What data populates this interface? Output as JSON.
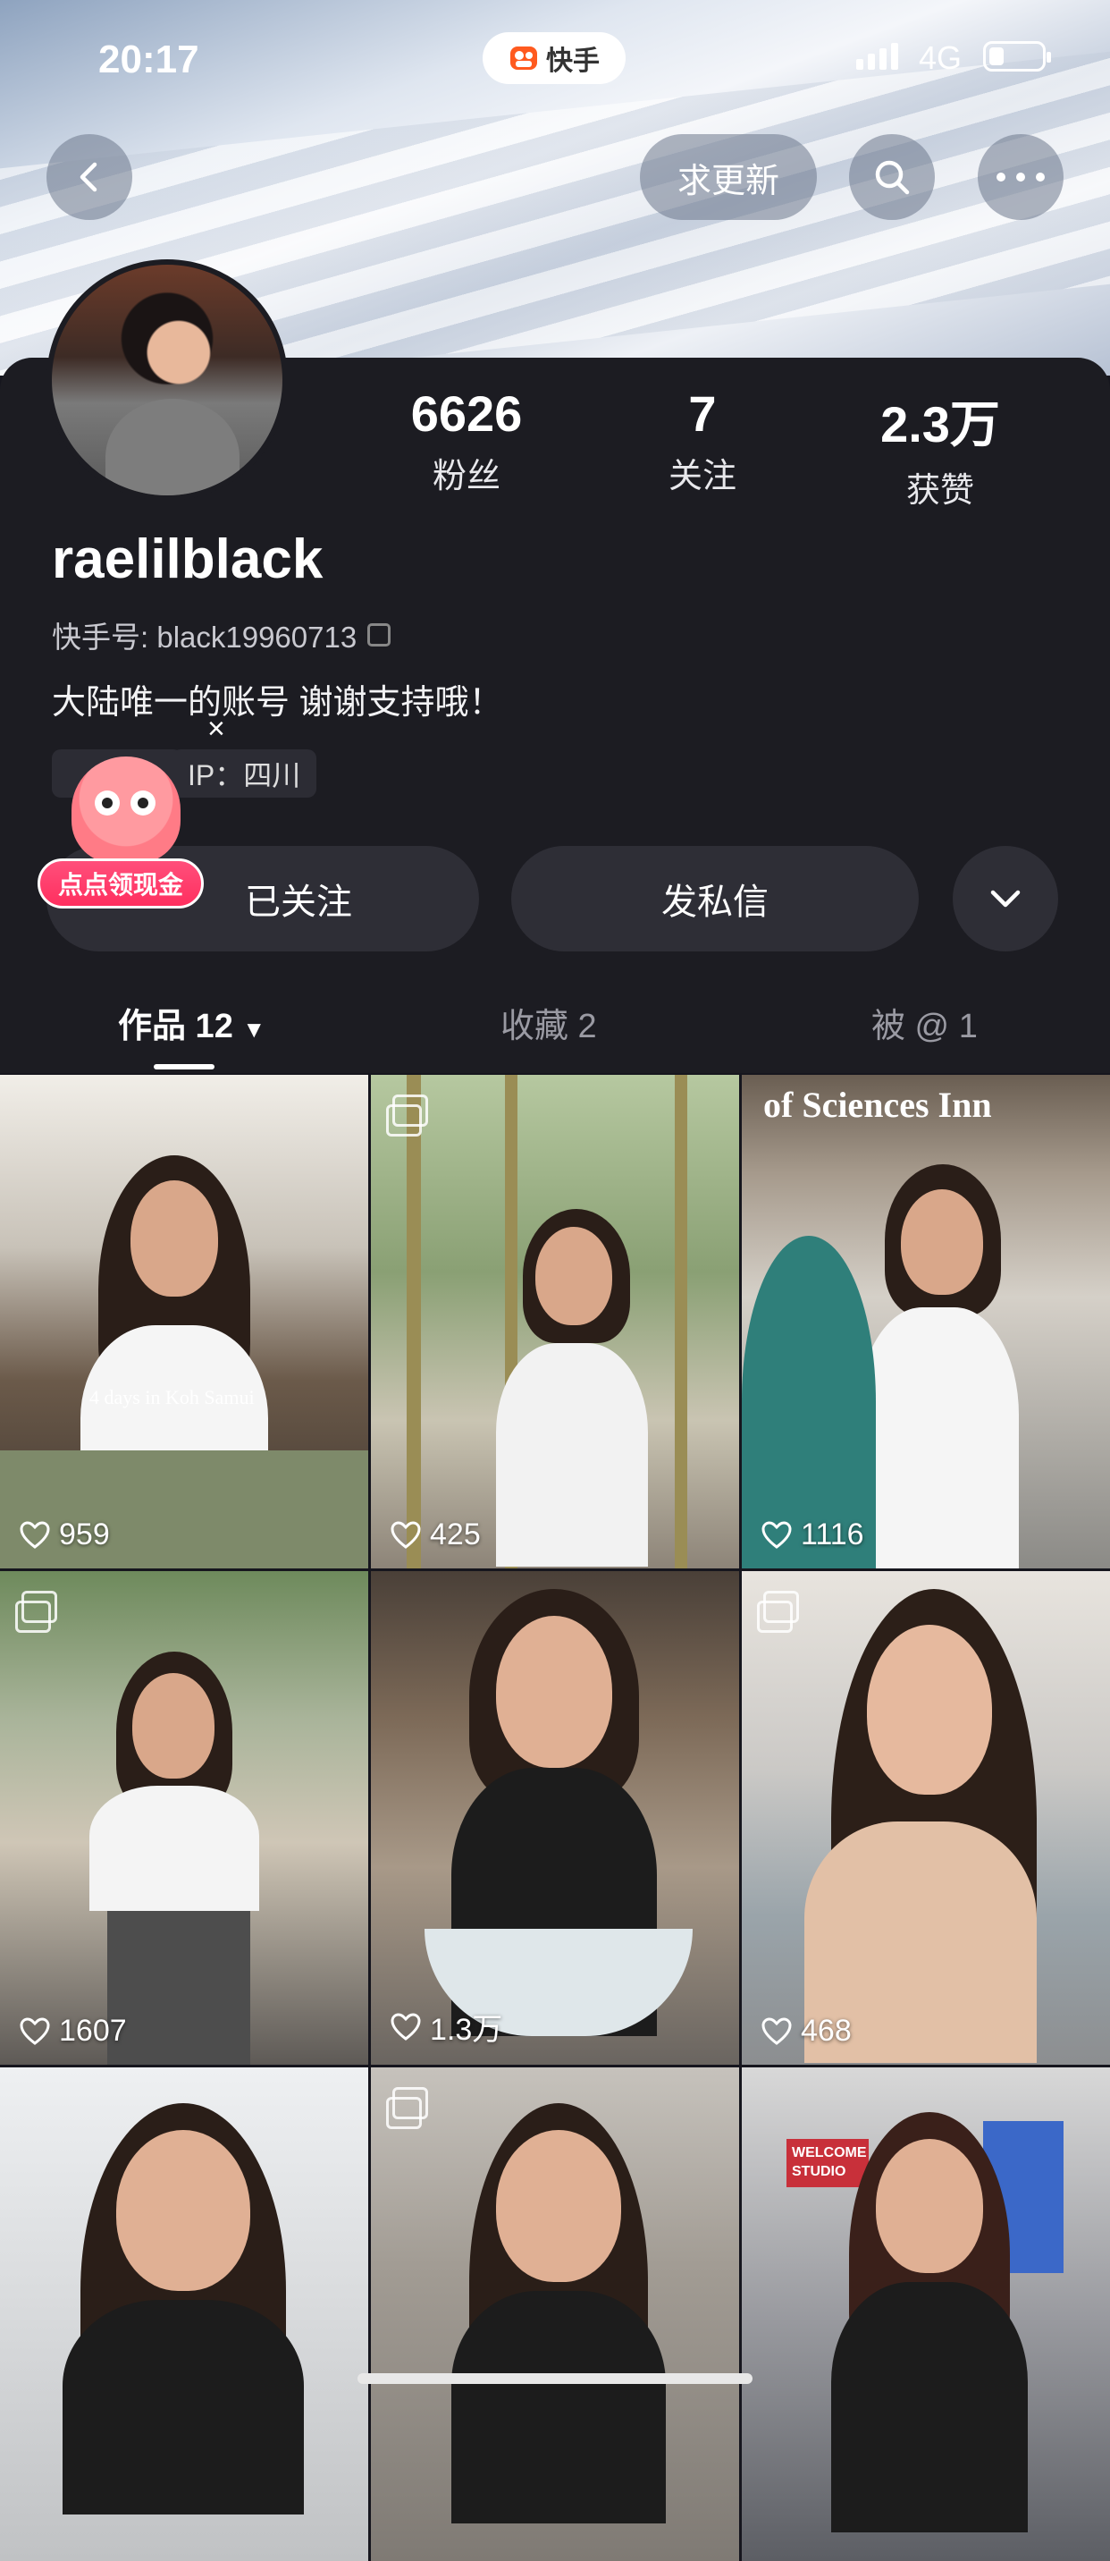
{
  "status_bar": {
    "time": "20:17",
    "app_name": "快手",
    "network": "4G",
    "battery_level": 0.25
  },
  "nav": {
    "update_label": "求更新"
  },
  "profile": {
    "stats": [
      {
        "value": "6626",
        "label": "粉丝"
      },
      {
        "value": "7",
        "label": "关注"
      },
      {
        "value": "2.3万",
        "label": "获赞"
      }
    ],
    "username": "raelilblack",
    "kuaishou_id": "快手号: black19960713",
    "bio": "大陆唯一的账号 谢谢支持哦！",
    "close_mark": "×",
    "gender_symbol": "♀",
    "ip_label": "IP：四川"
  },
  "promo": {
    "label": "点点领现金"
  },
  "actions": {
    "followed_label": "已关注",
    "message_label": "发私信"
  },
  "tabs": [
    {
      "label": "作品 12",
      "active": true
    },
    {
      "label": "收藏 2",
      "active": false
    },
    {
      "label": "被 @ 1",
      "active": false
    }
  ],
  "videos": [
    {
      "likes": "959",
      "album": false,
      "caption": "4 days in Koh Samui"
    },
    {
      "likes": "425",
      "album": true
    },
    {
      "likes": "1116",
      "album": false,
      "caption": "of Sciences Inn"
    },
    {
      "likes": "1607",
      "album": true
    },
    {
      "likes": "1.3万",
      "album": false
    },
    {
      "likes": "468",
      "album": true
    },
    {
      "likes": "",
      "album": false
    },
    {
      "likes": "",
      "album": true
    },
    {
      "likes": "",
      "album": false,
      "caption": "WELCOME STUDIO"
    }
  ],
  "colors": {
    "accent_pink": "#ff2f5f",
    "background": "#1c1c22",
    "button_bg": "#2e2e36"
  }
}
